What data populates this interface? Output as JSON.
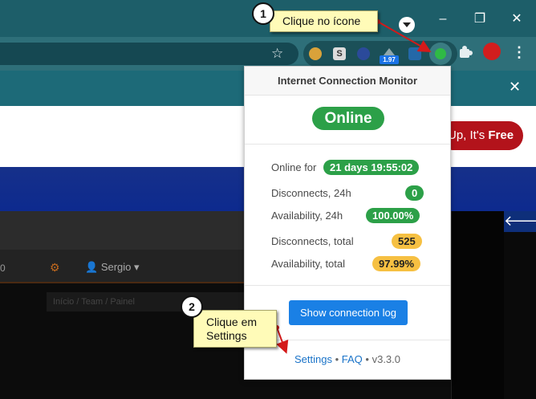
{
  "window": {
    "minimize_glyph": "–",
    "restore_glyph": "❐",
    "close_glyph": "✕"
  },
  "toolbar": {
    "bookmark_icon": "star-icon",
    "extension_badge": "1.97",
    "menu_glyph": "⋮"
  },
  "page": {
    "banner_close": "✕",
    "signup_prefix": "Up, It's ",
    "signup_bold": "Free",
    "user_name": "Sergio",
    "left_value": "0",
    "breadcrumb": "Início / Team / Painel",
    "back_glyph": "🡐"
  },
  "popup": {
    "title": "Internet Connection Monitor",
    "status": "Online",
    "stats": [
      {
        "label": "Online for",
        "value": "21 days 19:55:02",
        "color": "green"
      },
      {
        "label": "Disconnects, 24h",
        "value": "0",
        "color": "green"
      },
      {
        "label": "Availability, 24h",
        "value": "100.00%",
        "color": "green"
      },
      {
        "label": "Disconnects, total",
        "value": "525",
        "color": "yellow"
      },
      {
        "label": "Availability, total",
        "value": "97.99%",
        "color": "yellow"
      }
    ],
    "log_button": "Show connection log",
    "footer_settings": "Settings",
    "footer_sep": "•",
    "footer_faq": "FAQ",
    "footer_version": "v3.3.0"
  },
  "callouts": [
    {
      "number": "1",
      "text": "Clique no ícone"
    },
    {
      "number": "2",
      "text_line1": "Clique em",
      "text_line2": "Settings"
    }
  ],
  "colors": {
    "online_green": "#2ca048",
    "warning_yellow": "#f6c042",
    "button_blue": "#1a80e5",
    "callout_yellow": "#fffbb8",
    "arrow_red": "#d41a1a"
  }
}
